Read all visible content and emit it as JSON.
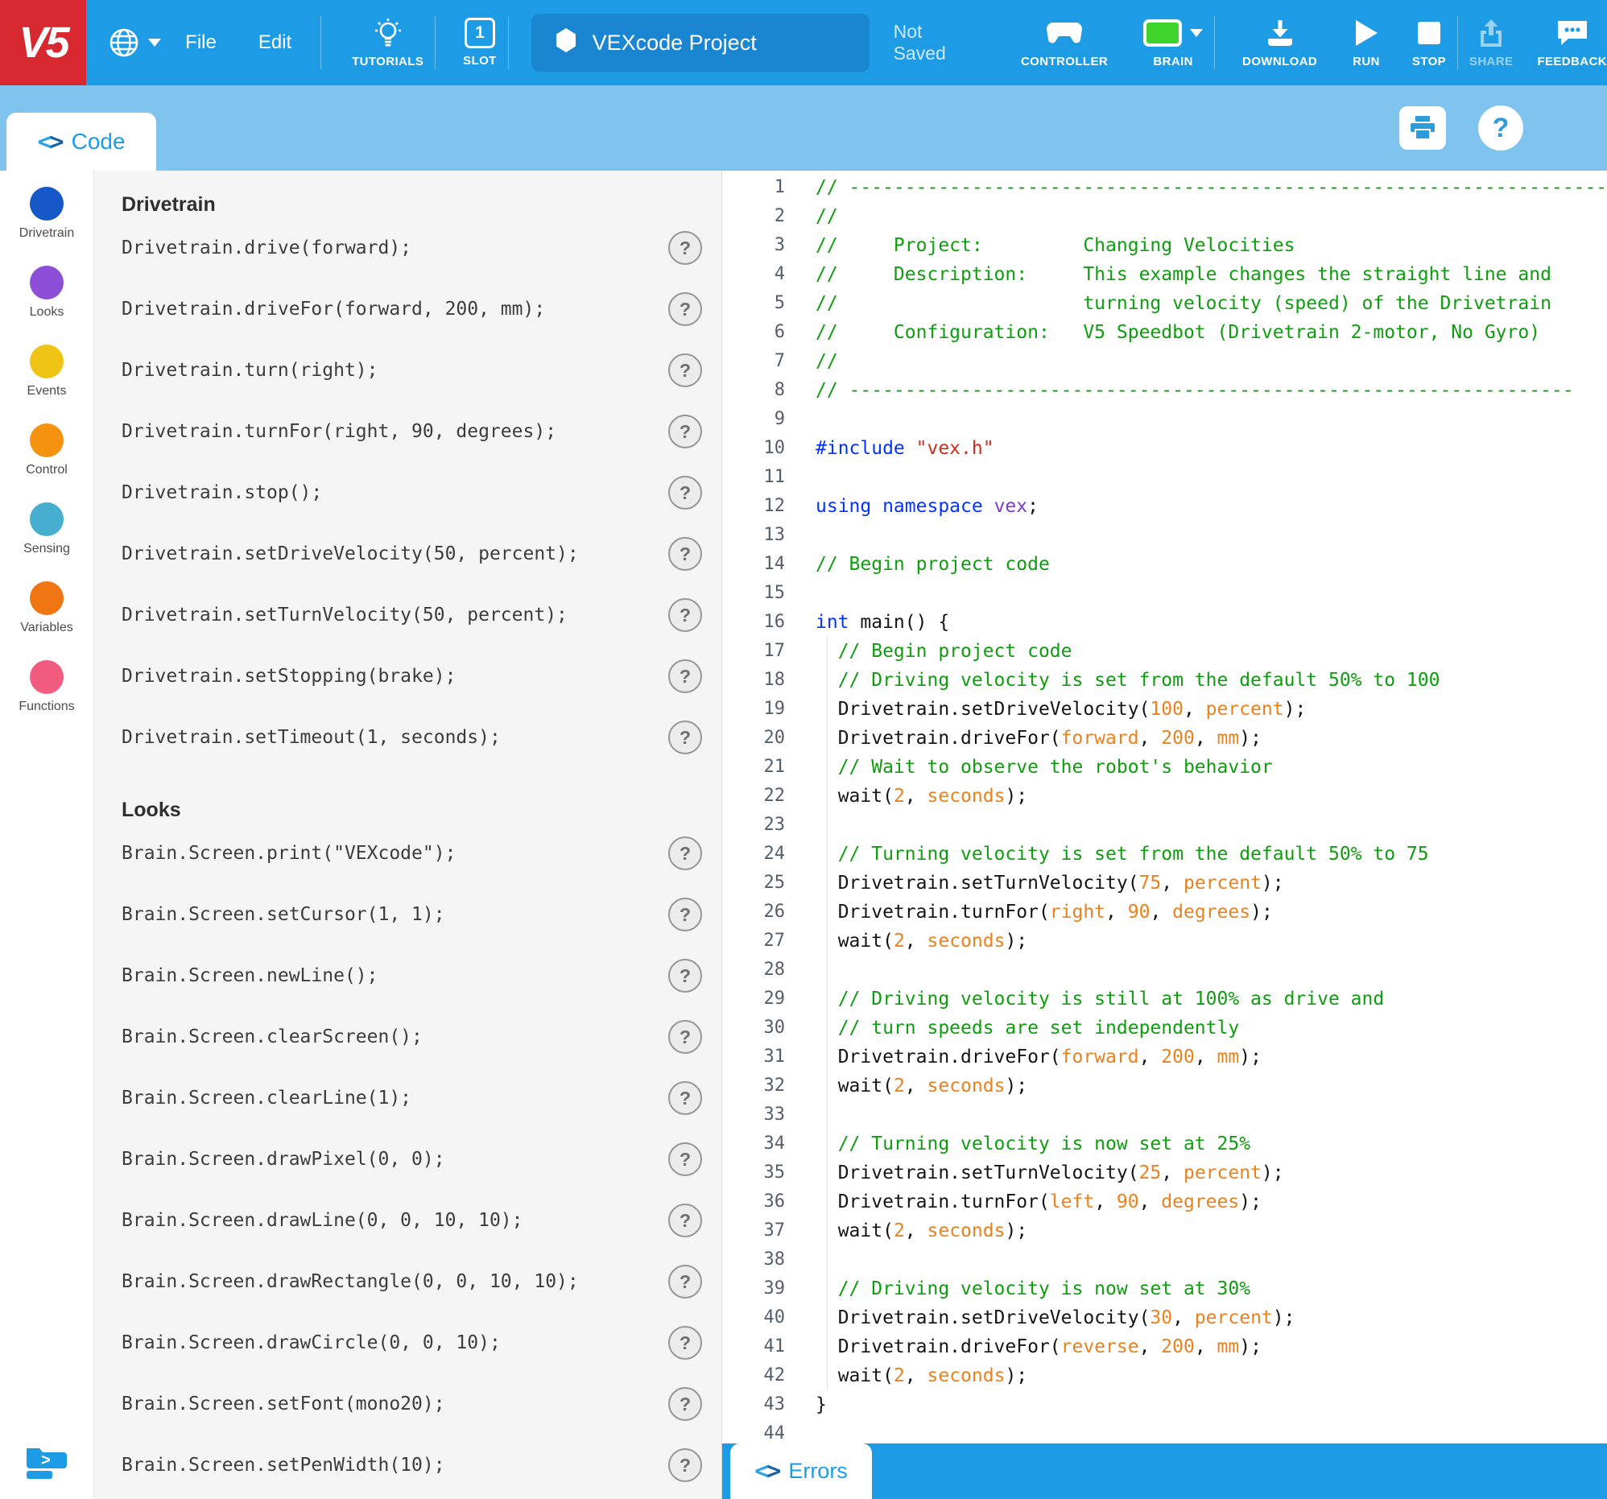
{
  "topbar": {
    "logo": "V5",
    "file": "File",
    "edit": "Edit",
    "tutorials": "TUTORIALS",
    "slot_label": "SLOT",
    "slot_number": "1",
    "project_title": "VEXcode Project",
    "save_status": "Not Saved",
    "controller_label": "CONTROLLER",
    "brain_label": "BRAIN",
    "download_label": "DOWNLOAD",
    "run_label": "RUN",
    "stop_label": "STOP",
    "share_label": "SHARE",
    "feedback_label": "FEEDBACK",
    "brain_status_color": "#3FD42C",
    "bar_color": "#1D9CE5",
    "logo_color": "#D7282F"
  },
  "subbar": {
    "code_tab": "Code",
    "help_glyph": "?"
  },
  "sidebar": {
    "categories": [
      {
        "label": "Drivetrain",
        "color": "#1758C8"
      },
      {
        "label": "Looks",
        "color": "#8E4FD8"
      },
      {
        "label": "Events",
        "color": "#F0C414"
      },
      {
        "label": "Control",
        "color": "#F5920F"
      },
      {
        "label": "Sensing",
        "color": "#46AECE"
      },
      {
        "label": "Variables",
        "color": "#F07613"
      },
      {
        "label": "Functions",
        "color": "#F25C7F"
      }
    ]
  },
  "commands": {
    "help_glyph": "?",
    "sections": [
      {
        "title": "Drivetrain",
        "items": [
          "Drivetrain.drive(forward);",
          "Drivetrain.driveFor(forward, 200, mm);",
          "Drivetrain.turn(right);",
          "Drivetrain.turnFor(right, 90, degrees);",
          "Drivetrain.stop();",
          "Drivetrain.setDriveVelocity(50, percent);",
          "Drivetrain.setTurnVelocity(50, percent);",
          "Drivetrain.setStopping(brake);",
          "Drivetrain.setTimeout(1, seconds);"
        ]
      },
      {
        "title": "Looks",
        "items": [
          "Brain.Screen.print(\"VEXcode\");",
          "Brain.Screen.setCursor(1, 1);",
          "Brain.Screen.newLine();",
          "Brain.Screen.clearScreen();",
          "Brain.Screen.clearLine(1);",
          "Brain.Screen.drawPixel(0, 0);",
          "Brain.Screen.drawLine(0, 0, 10, 10);",
          "Brain.Screen.drawRectangle(0, 0, 10, 10);",
          "Brain.Screen.drawCircle(0, 0, 10);",
          "Brain.Screen.setFont(mono20);",
          "Brain.Screen.setPenWidth(10);"
        ]
      }
    ]
  },
  "editor": {
    "first_line_number": 1,
    "syntax_colors": {
      "comment": "#109c10",
      "keyword": "#0433FA",
      "string": "#CB2C1D",
      "namespace": "#7B3FC4",
      "value": "#E8821E",
      "plain": "#141414"
    },
    "lines": [
      [
        [
          "c",
          "// ---------------------------------------------------------------------------"
        ]
      ],
      [
        [
          "c",
          "// "
        ]
      ],
      [
        [
          "c",
          "//     Project:         Changing Velocities"
        ]
      ],
      [
        [
          "c",
          "//     Description:     This example changes the straight line and"
        ]
      ],
      [
        [
          "c",
          "//                      turning velocity (speed) of the Drivetrain"
        ]
      ],
      [
        [
          "c",
          "//     Configuration:   V5 Speedbot (Drivetrain 2-motor, No Gyro)"
        ]
      ],
      [
        [
          "c",
          "//"
        ]
      ],
      [
        [
          "c",
          "// -----------------------------------------------------------------"
        ]
      ],
      [],
      [
        [
          "k",
          "#include "
        ],
        [
          "s",
          "\"vex.h\""
        ]
      ],
      [],
      [
        [
          "k",
          "using namespace"
        ],
        [
          "p",
          " "
        ],
        [
          "n",
          "vex"
        ],
        [
          "p",
          ";"
        ]
      ],
      [],
      [
        [
          "c",
          "// Begin project code"
        ]
      ],
      [],
      [
        [
          "k",
          "int"
        ],
        [
          "p",
          " main() {"
        ]
      ],
      [
        [
          "c",
          "  // Begin project code"
        ]
      ],
      [
        [
          "c",
          "  // Driving velocity is set from the default 50% to 100"
        ]
      ],
      [
        [
          "p",
          "  Drivetrain.setDriveVelocity("
        ],
        [
          "v",
          "100"
        ],
        [
          "p",
          ", "
        ],
        [
          "v",
          "percent"
        ],
        [
          "p",
          ");"
        ]
      ],
      [
        [
          "p",
          "  Drivetrain.driveFor("
        ],
        [
          "v",
          "forward"
        ],
        [
          "p",
          ", "
        ],
        [
          "v",
          "200"
        ],
        [
          "p",
          ", "
        ],
        [
          "v",
          "mm"
        ],
        [
          "p",
          ");"
        ]
      ],
      [
        [
          "c",
          "  // Wait to observe the robot's behavior"
        ]
      ],
      [
        [
          "p",
          "  wait("
        ],
        [
          "v",
          "2"
        ],
        [
          "p",
          ", "
        ],
        [
          "v",
          "seconds"
        ],
        [
          "p",
          ");"
        ]
      ],
      [],
      [
        [
          "c",
          "  // Turning velocity is set from the default 50% to 75"
        ]
      ],
      [
        [
          "p",
          "  Drivetrain.setTurnVelocity("
        ],
        [
          "v",
          "75"
        ],
        [
          "p",
          ", "
        ],
        [
          "v",
          "percent"
        ],
        [
          "p",
          ");"
        ]
      ],
      [
        [
          "p",
          "  Drivetrain.turnFor("
        ],
        [
          "v",
          "right"
        ],
        [
          "p",
          ", "
        ],
        [
          "v",
          "90"
        ],
        [
          "p",
          ", "
        ],
        [
          "v",
          "degrees"
        ],
        [
          "p",
          ");"
        ]
      ],
      [
        [
          "p",
          "  wait("
        ],
        [
          "v",
          "2"
        ],
        [
          "p",
          ", "
        ],
        [
          "v",
          "seconds"
        ],
        [
          "p",
          ");"
        ]
      ],
      [],
      [
        [
          "c",
          "  // Driving velocity is still at 100% as drive and"
        ]
      ],
      [
        [
          "c",
          "  // turn speeds are set independently"
        ]
      ],
      [
        [
          "p",
          "  Drivetrain.driveFor("
        ],
        [
          "v",
          "forward"
        ],
        [
          "p",
          ", "
        ],
        [
          "v",
          "200"
        ],
        [
          "p",
          ", "
        ],
        [
          "v",
          "mm"
        ],
        [
          "p",
          ");"
        ]
      ],
      [
        [
          "p",
          "  wait("
        ],
        [
          "v",
          "2"
        ],
        [
          "p",
          ", "
        ],
        [
          "v",
          "seconds"
        ],
        [
          "p",
          ");"
        ]
      ],
      [],
      [
        [
          "c",
          "  // Turning velocity is now set at 25%"
        ]
      ],
      [
        [
          "p",
          "  Drivetrain.setTurnVelocity("
        ],
        [
          "v",
          "25"
        ],
        [
          "p",
          ", "
        ],
        [
          "v",
          "percent"
        ],
        [
          "p",
          ");"
        ]
      ],
      [
        [
          "p",
          "  Drivetrain.turnFor("
        ],
        [
          "v",
          "left"
        ],
        [
          "p",
          ", "
        ],
        [
          "v",
          "90"
        ],
        [
          "p",
          ", "
        ],
        [
          "v",
          "degrees"
        ],
        [
          "p",
          ");"
        ]
      ],
      [
        [
          "p",
          "  wait("
        ],
        [
          "v",
          "2"
        ],
        [
          "p",
          ", "
        ],
        [
          "v",
          "seconds"
        ],
        [
          "p",
          ");"
        ]
      ],
      [],
      [
        [
          "c",
          "  // Driving velocity is now set at 30%"
        ]
      ],
      [
        [
          "p",
          "  Drivetrain.setDriveVelocity("
        ],
        [
          "v",
          "30"
        ],
        [
          "p",
          ", "
        ],
        [
          "v",
          "percent"
        ],
        [
          "p",
          ");"
        ]
      ],
      [
        [
          "p",
          "  Drivetrain.driveFor("
        ],
        [
          "v",
          "reverse"
        ],
        [
          "p",
          ", "
        ],
        [
          "v",
          "200"
        ],
        [
          "p",
          ", "
        ],
        [
          "v",
          "mm"
        ],
        [
          "p",
          ");"
        ]
      ],
      [
        [
          "p",
          "  wait("
        ],
        [
          "v",
          "2"
        ],
        [
          "p",
          ", "
        ],
        [
          "v",
          "seconds"
        ],
        [
          "p",
          ");"
        ]
      ],
      [
        [
          "p",
          "}"
        ]
      ],
      []
    ]
  },
  "errorsbar": {
    "label": "Errors"
  }
}
